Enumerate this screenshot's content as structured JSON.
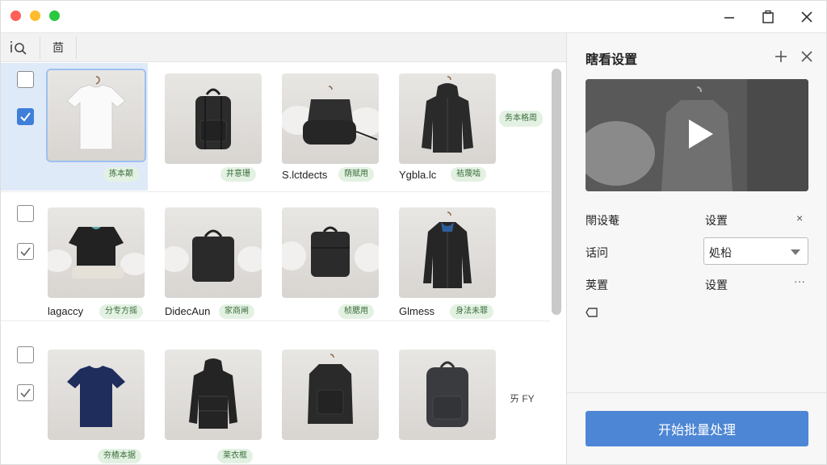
{
  "toolbar": {
    "search_icon": "search-icon",
    "filter_icon": "filter-icon",
    "filter_label": "茴"
  },
  "grid": {
    "rows": [
      {
        "items": [
          {
            "caption": "",
            "tag": "拣本颠",
            "image": "white t-shirt on hanger",
            "selected": true
          },
          {
            "caption": "",
            "tag": "井意珊",
            "image": "black backpack"
          },
          {
            "caption": "S.lctdects",
            "tag": "荫赋用",
            "image": "black bag on pillows"
          },
          {
            "caption": "Ygbla.lc",
            "tag": "袺蔑啮",
            "image": "black hooded jacket",
            "side_tag": "务本格周"
          }
        ]
      },
      {
        "items": [
          {
            "caption": "lagaccy",
            "tag": "分专方摇",
            "image": "folded black clothes"
          },
          {
            "caption": "DidecAun",
            "tag": "家商闸",
            "image": "black box bag"
          },
          {
            "caption": "",
            "tag": "桢腮用",
            "image": "black case bag"
          },
          {
            "caption": "Glmess",
            "tag": "身法未罪",
            "image": "black jacket on hanger"
          }
        ]
      },
      {
        "items": [
          {
            "caption": "",
            "tag": "夯楂本据",
            "image": "navy t-shirt"
          },
          {
            "caption": "",
            "tag": "莱衣框",
            "image": "black puffer jacket"
          },
          {
            "caption": "",
            "tag": "",
            "image": "black backpack on hanger"
          },
          {
            "caption": "",
            "tag": "",
            "image": "grey backpack",
            "side_tag": "ㄞ FY"
          }
        ]
      }
    ]
  },
  "panel": {
    "title": "瞎看设置",
    "add_icon": "plus-icon",
    "close_icon": "close-icon",
    "video_icon": "play-icon",
    "props": [
      {
        "label": "閝设菴",
        "value": "设置",
        "action": "×"
      },
      {
        "label": "话问",
        "value": "",
        "action": ""
      },
      {
        "label": "荚置",
        "value": "设置",
        "action": "···"
      }
    ],
    "dropdown": {
      "value": "処柗"
    },
    "extra_icon": "tag-icon",
    "start_button": "开始批量处理"
  },
  "colors": {
    "accent": "#4d86d4",
    "selected_bg": "#dfeaf8",
    "checkbox_blue": "#3f7fd9",
    "tag_bg": "#e3f1e3",
    "tag_text": "#3c6e3c"
  }
}
